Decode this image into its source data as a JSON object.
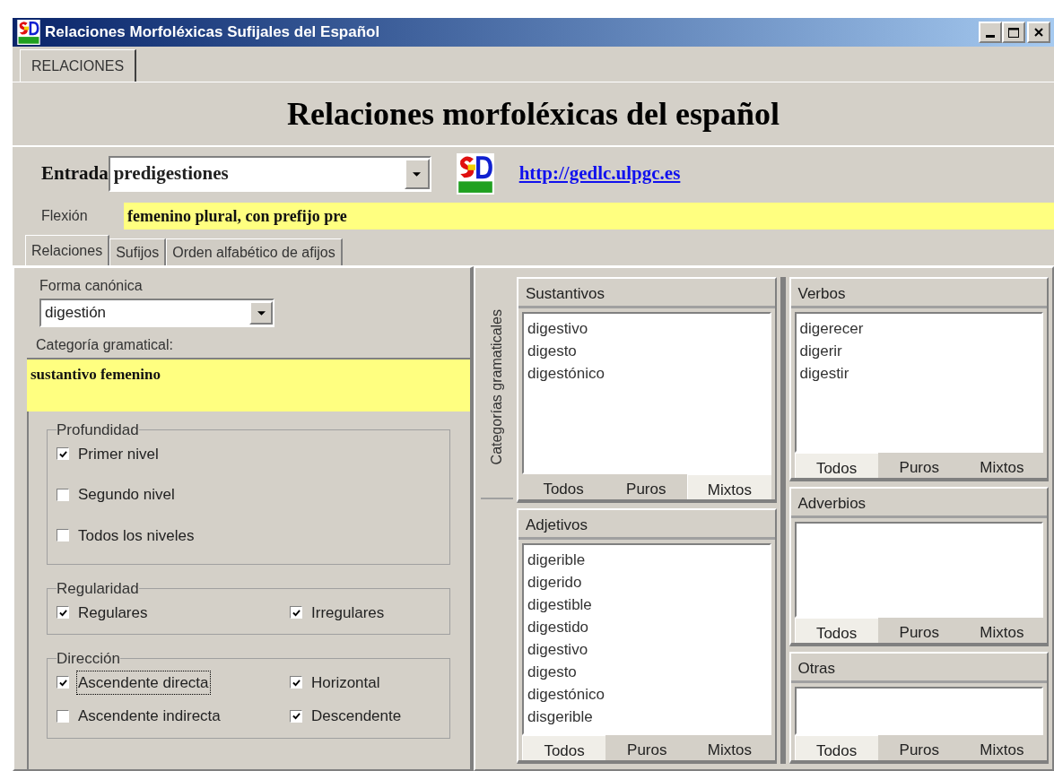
{
  "window": {
    "title": "Relaciones Morfoléxicas Sufijales del Español"
  },
  "top_tabs": [
    {
      "label": "RELACIONES",
      "selected": true
    }
  ],
  "heading": "Relaciones morfoléxicas del español",
  "entrada": {
    "label": "Entrada",
    "value": "predigestiones"
  },
  "link": "http://gedlc.ulpgc.es",
  "flexion": {
    "label": "Flexión",
    "value": "femenino plural, con prefijo pre"
  },
  "tabs": [
    {
      "label": "Relaciones",
      "selected": true
    },
    {
      "label": "Sufijos",
      "selected": false
    },
    {
      "label": "Orden alfabético de afijos",
      "selected": false
    }
  ],
  "forma_canonica": {
    "label": "Forma canónica",
    "value": "digestión"
  },
  "categoria": {
    "label": "Categoría gramatical:",
    "value": "sustantivo femenino"
  },
  "groups": [
    {
      "title": "Profundidad",
      "kind": "column",
      "options": [
        {
          "label": "Primer nivel",
          "checked": true,
          "focused": false
        },
        {
          "label": "Segundo nivel",
          "checked": false,
          "focused": false
        },
        {
          "label": "Todos los niveles",
          "checked": false,
          "focused": false
        }
      ]
    },
    {
      "title": "Regularidad",
      "kind": "grid",
      "options": [
        {
          "label": "Regulares",
          "checked": true,
          "focused": false
        },
        {
          "label": "Irregulares",
          "checked": true,
          "focused": false
        }
      ]
    },
    {
      "title": "Dirección",
      "kind": "grid",
      "options": [
        {
          "label": "Ascendente directa",
          "checked": true,
          "focused": true
        },
        {
          "label": "Horizontal",
          "checked": true,
          "focused": false
        },
        {
          "label": "Ascendente indirecta",
          "checked": false,
          "focused": false
        },
        {
          "label": "Descendente",
          "checked": true,
          "focused": false
        }
      ]
    }
  ],
  "side_tab": "Categorías gramaticales",
  "columns": [
    [
      {
        "title": "Sustantivos",
        "items": [
          "digestivo",
          "digesto",
          "digestónico"
        ],
        "filters": [
          {
            "label": "Todos",
            "selected": false
          },
          {
            "label": "Puros",
            "selected": false
          },
          {
            "label": "Mixtos",
            "selected": true
          }
        ]
      },
      {
        "title": "Adjetivos",
        "items": [
          "digerible",
          "digerido",
          "digestible",
          "digestido",
          "digestivo",
          "digesto",
          "digestónico",
          "disgerible"
        ],
        "filters": [
          {
            "label": "Todos",
            "selected": true
          },
          {
            "label": "Puros",
            "selected": false
          },
          {
            "label": "Mixtos",
            "selected": false
          }
        ]
      }
    ],
    [
      {
        "title": "Verbos",
        "items": [
          "digerecer",
          "digerir",
          "digestir"
        ],
        "filters": [
          {
            "label": "Todos",
            "selected": true
          },
          {
            "label": "Puros",
            "selected": false
          },
          {
            "label": "Mixtos",
            "selected": false
          }
        ]
      },
      {
        "title": "Adverbios",
        "filters": [
          {
            "label": "Todos",
            "selected": true
          },
          {
            "label": "Puros",
            "selected": false
          },
          {
            "label": "Mixtos",
            "selected": false
          }
        ]
      },
      {
        "title": "Otras",
        "filters": [
          {
            "label": "Todos",
            "selected": true
          },
          {
            "label": "Puros",
            "selected": false
          },
          {
            "label": "Mixtos",
            "selected": false
          }
        ]
      }
    ]
  ]
}
